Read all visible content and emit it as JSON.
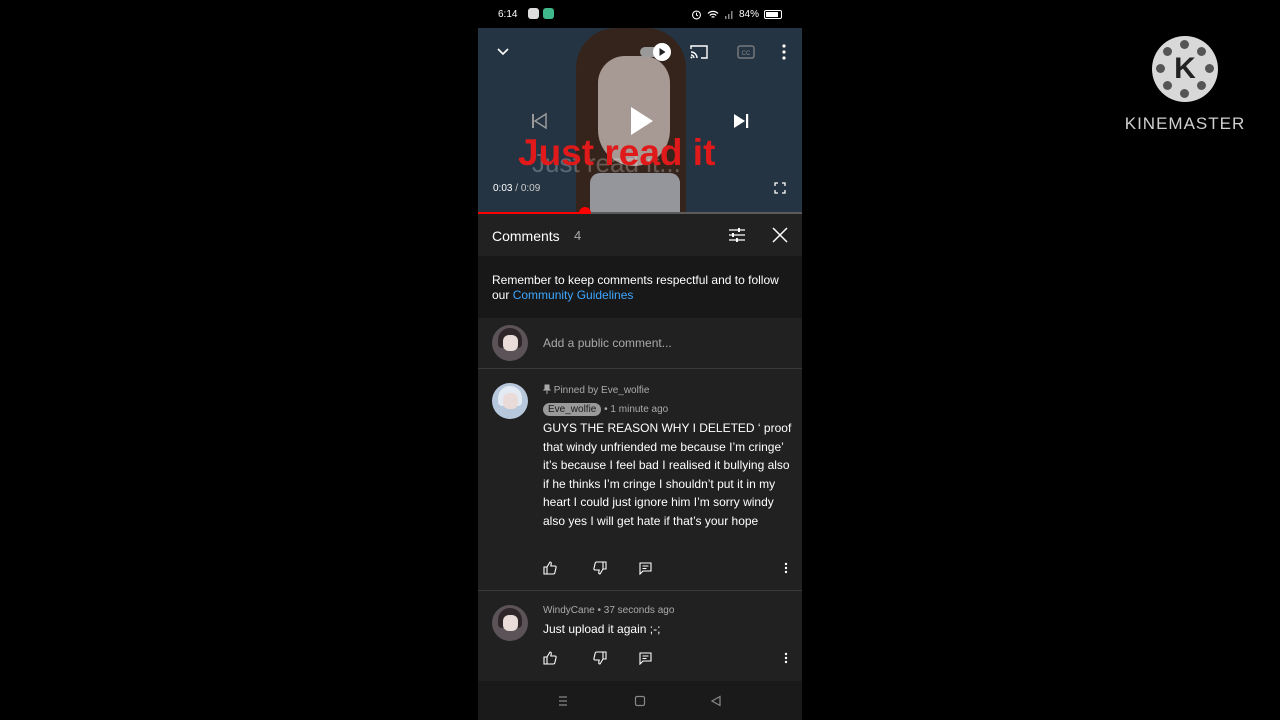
{
  "watermark": {
    "letter": "K",
    "brand": "KINEMASTER"
  },
  "status_bar": {
    "time": "6:14",
    "battery": "84%",
    "battery_level": 0.84
  },
  "video": {
    "overlay_text": "Just read it",
    "ghost_text": "Just read it...",
    "current_time": "0:03",
    "separator": " / ",
    "duration": "0:09",
    "progress": 0.33
  },
  "comments_panel": {
    "title": "Comments",
    "count": "4",
    "notice_text": "Remember to keep comments respectful and to follow our ",
    "notice_link": "Community Guidelines",
    "add_placeholder": "Add a public comment..."
  },
  "comments": [
    {
      "pinned_label": "Pinned by Eve_wolfie",
      "author": "Eve_wolfie",
      "time": "1 minute ago",
      "text": "GUYS THE REASON WHY I DELETED ‘ proof that windy unfriended me because I’m cringe’ it’s because I feel bad I realised it bullying also if he thinks I’m cringe I shouldn’t put it in my heart I could just ignore him I’m sorry windy also yes I will get hate if that’s your hope"
    },
    {
      "author": "WindyCane",
      "time": "37 seconds ago",
      "text": "Just upload it again ;-;"
    }
  ],
  "meta_separator": " • ",
  "colors": {
    "accent": "#ff0000",
    "link": "#3ea6ff",
    "panel": "#212121"
  },
  "icons": [
    "chevron-down-icon",
    "autoplay-toggle-icon",
    "cast-icon",
    "cc-icon",
    "more-vert-icon",
    "previous-icon",
    "play-icon",
    "next-icon",
    "fullscreen-icon",
    "filter-icon",
    "close-icon",
    "pin-icon",
    "like-icon",
    "dislike-icon",
    "reply-icon"
  ]
}
